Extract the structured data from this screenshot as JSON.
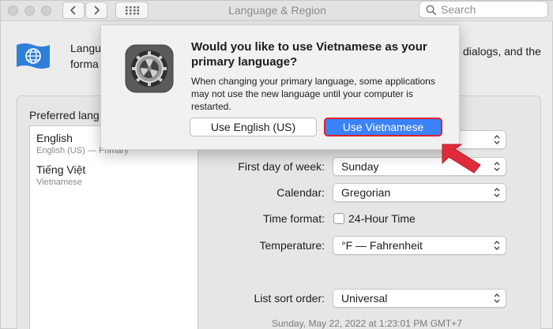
{
  "window": {
    "title": "Language & Region"
  },
  "search": {
    "placeholder": "Search"
  },
  "header": {
    "text_line1_start": "Langu",
    "text_line2_start": "forma",
    "text_line1_end": "dialogs, and the"
  },
  "preferred": {
    "label": "Preferred lang",
    "languages": [
      {
        "name": "English",
        "sub": "English (US) — Primary"
      },
      {
        "name": "Tiếng Việt",
        "sub": "Vietnamese"
      }
    ]
  },
  "settings": {
    "first_day_label": "First day of week:",
    "first_day_value": "Sunday",
    "calendar_label": "Calendar:",
    "calendar_value": "Gregorian",
    "time_format_label": "Time format:",
    "time_format_option": "24-Hour Time",
    "temperature_label": "Temperature:",
    "temperature_value": "°F — Fahrenheit",
    "sort_label": "List sort order:",
    "sort_value": "Universal",
    "date_preview": "Sunday, May 22, 2022 at 1:23:01 PM GMT+7"
  },
  "dialog": {
    "title": "Would you like to use Vietnamese as your primary language?",
    "body": "When changing your primary language, some applications may not use the new language until your computer is restarted.",
    "btn_english": "Use English (US)",
    "btn_vietnamese": "Use Vietnamese"
  },
  "colors": {
    "accent": "#3b82f7",
    "highlight": "#e0212b"
  }
}
